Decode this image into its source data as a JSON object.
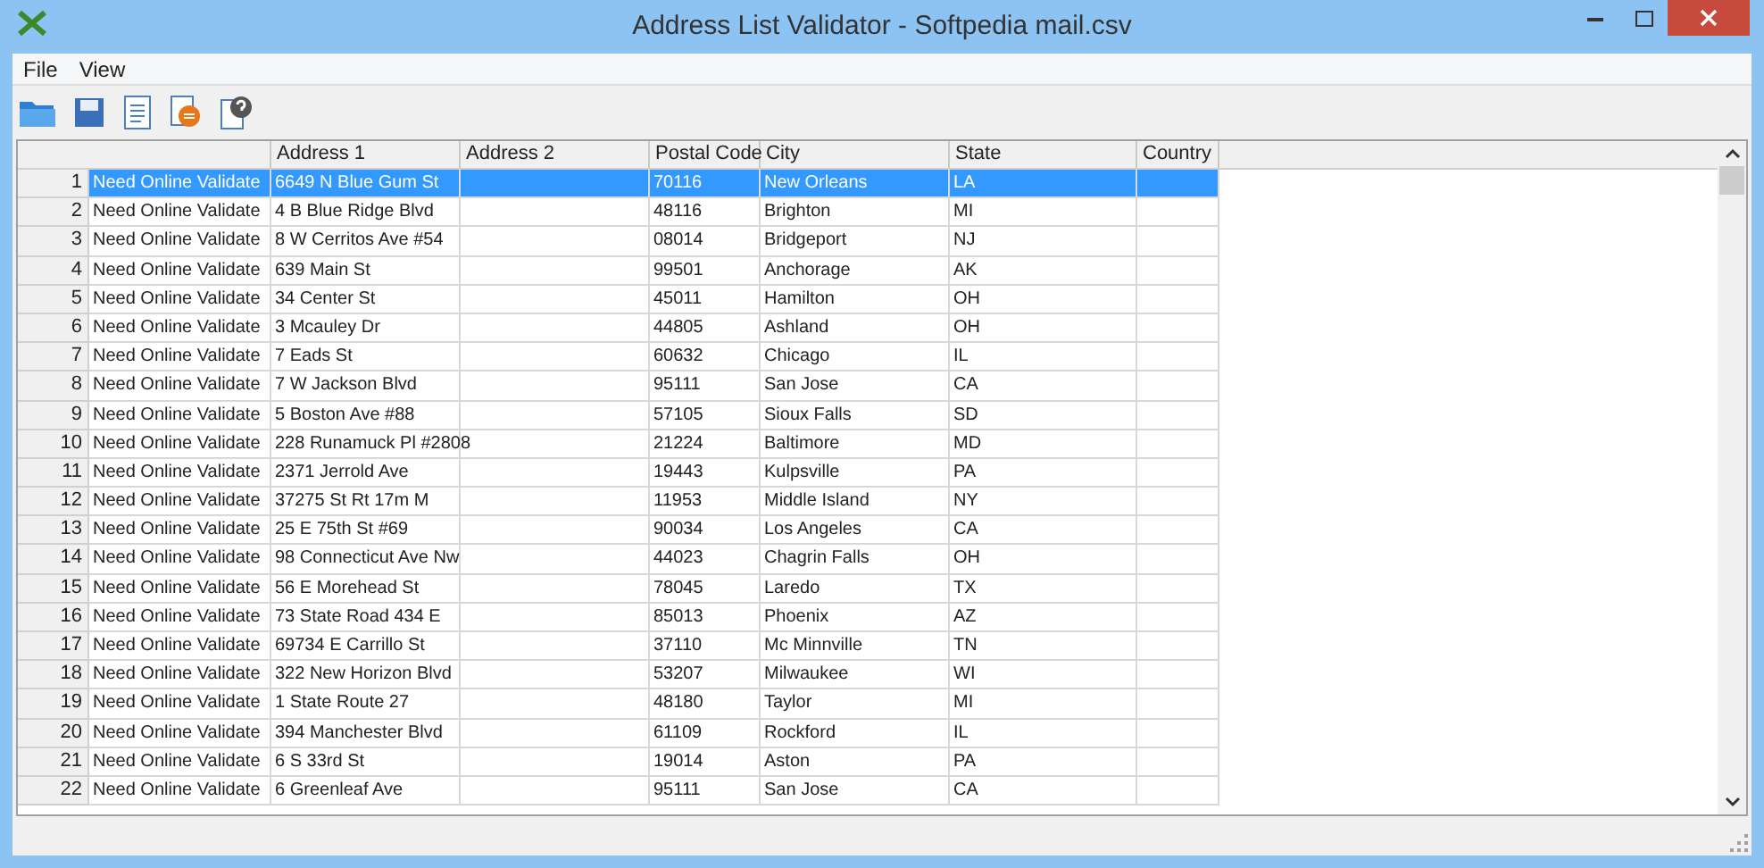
{
  "window": {
    "title": "Address List Validator - Softpedia mail.csv"
  },
  "menu": [
    "File",
    "View"
  ],
  "toolbar": [
    {
      "kind": "open"
    },
    {
      "kind": "save"
    },
    {
      "kind": "list"
    },
    {
      "kind": "stop"
    },
    {
      "kind": "help"
    }
  ],
  "table": {
    "columns": [
      "Address 1",
      "Address 2",
      "Postal Code",
      "City",
      "State",
      "Country"
    ],
    "rows": [
      {
        "number": "1",
        "status": "Need Online Validate",
        "address_1": "6649 N Blue Gum St",
        "postal_code": "70116",
        "city": "New Orleans",
        "state": "LA",
        "selected": true
      },
      {
        "number": "2",
        "status": "Need Online Validate",
        "address_1": "4 B Blue Ridge Blvd",
        "postal_code": "48116",
        "city": "Brighton",
        "state": "MI",
        "selected": false
      },
      {
        "number": "3",
        "status": "Need Online Validate",
        "address_1": "8 W Cerritos Ave #54",
        "postal_code": "08014",
        "city": "Bridgeport",
        "state": "NJ",
        "selected": false
      },
      {
        "number": "4",
        "status": "Need Online Validate",
        "address_1": "639 Main St",
        "postal_code": "99501",
        "city": "Anchorage",
        "state": "AK",
        "selected": false
      },
      {
        "number": "5",
        "status": "Need Online Validate",
        "address_1": "34 Center St",
        "postal_code": "45011",
        "city": "Hamilton",
        "state": "OH",
        "selected": false
      },
      {
        "number": "6",
        "status": "Need Online Validate",
        "address_1": "3 Mcauley Dr",
        "postal_code": "44805",
        "city": "Ashland",
        "state": "OH",
        "selected": false
      },
      {
        "number": "7",
        "status": "Need Online Validate",
        "address_1": "7 Eads St",
        "postal_code": "60632",
        "city": "Chicago",
        "state": "IL",
        "selected": false
      },
      {
        "number": "8",
        "status": "Need Online Validate",
        "address_1": "7 W Jackson Blvd",
        "postal_code": "95111",
        "city": "San Jose",
        "state": "CA",
        "selected": false
      },
      {
        "number": "9",
        "status": "Need Online Validate",
        "address_1": "5 Boston Ave #88",
        "postal_code": "57105",
        "city": "Sioux Falls",
        "state": "SD",
        "selected": false
      },
      {
        "number": "10",
        "status": "Need Online Validate",
        "address_1": "228 Runamuck Pl #2808",
        "postal_code": "21224",
        "city": "Baltimore",
        "state": "MD",
        "selected": false
      },
      {
        "number": "11",
        "status": "Need Online Validate",
        "address_1": "2371 Jerrold Ave",
        "postal_code": "19443",
        "city": "Kulpsville",
        "state": "PA",
        "selected": false
      },
      {
        "number": "12",
        "status": "Need Online Validate",
        "address_1": "37275 St  Rt 17m M",
        "postal_code": "11953",
        "city": "Middle Island",
        "state": "NY",
        "selected": false
      },
      {
        "number": "13",
        "status": "Need Online Validate",
        "address_1": "25 E 75th St #69",
        "postal_code": "90034",
        "city": "Los Angeles",
        "state": "CA",
        "selected": false
      },
      {
        "number": "14",
        "status": "Need Online Validate",
        "address_1": "98 Connecticut Ave Nw",
        "postal_code": "44023",
        "city": "Chagrin Falls",
        "state": "OH",
        "selected": false
      },
      {
        "number": "15",
        "status": "Need Online Validate",
        "address_1": "56 E Morehead St",
        "postal_code": "78045",
        "city": "Laredo",
        "state": "TX",
        "selected": false
      },
      {
        "number": "16",
        "status": "Need Online Validate",
        "address_1": "73 State Road 434 E",
        "postal_code": "85013",
        "city": "Phoenix",
        "state": "AZ",
        "selected": false
      },
      {
        "number": "17",
        "status": "Need Online Validate",
        "address_1": "69734 E Carrillo St",
        "postal_code": "37110",
        "city": "Mc Minnville",
        "state": "TN",
        "selected": false
      },
      {
        "number": "18",
        "status": "Need Online Validate",
        "address_1": "322 New Horizon Blvd",
        "postal_code": "53207",
        "city": "Milwaukee",
        "state": "WI",
        "selected": false
      },
      {
        "number": "19",
        "status": "Need Online Validate",
        "address_1": "1 State Route 27",
        "postal_code": "48180",
        "city": "Taylor",
        "state": "MI",
        "selected": false
      },
      {
        "number": "20",
        "status": "Need Online Validate",
        "address_1": "394 Manchester Blvd",
        "postal_code": "61109",
        "city": "Rockford",
        "state": "IL",
        "selected": false
      },
      {
        "number": "21",
        "status": "Need Online Validate",
        "address_1": "6 S 33rd St",
        "postal_code": "19014",
        "city": "Aston",
        "state": "PA",
        "selected": false
      },
      {
        "number": "22",
        "status": "Need Online Validate",
        "address_1": "6 Greenleaf Ave",
        "postal_code": "95111",
        "city": "San Jose",
        "state": "CA",
        "selected": false
      }
    ]
  }
}
